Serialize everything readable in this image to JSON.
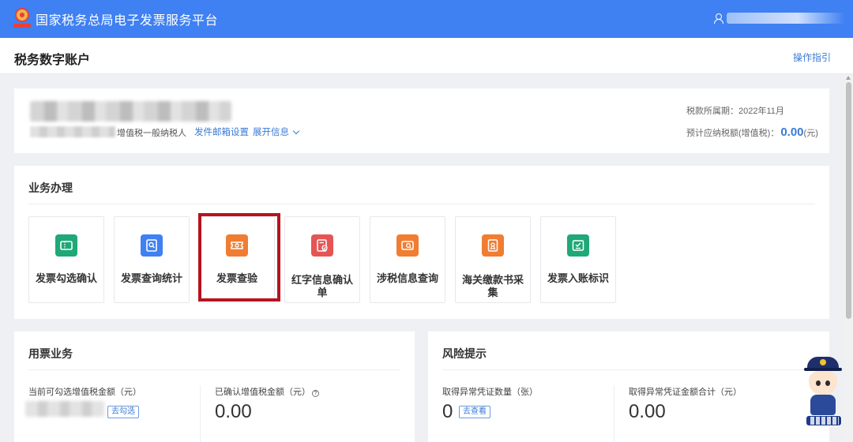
{
  "topbar": {
    "title": "国家税务总局电子发票服务平台",
    "logo_icon": "tax-emblem-icon",
    "user_icon": "user-icon",
    "accent_color": "#3f80f2"
  },
  "header": {
    "page_title": "税务数字账户",
    "guide_link": "操作指引"
  },
  "account": {
    "taxpayer_type": "增值税一般纳税人",
    "email_setting_link": "发件邮箱设置",
    "expand_link": "展开信息",
    "tax_period": "税款所属期：2022年11月",
    "estimated_tax_label": "预计应纳税额(增值税)：",
    "estimated_tax_value": "0.00",
    "estimated_tax_unit": "(元)"
  },
  "business": {
    "title": "业务办理",
    "highlight_color": "#b5141f",
    "tiles": [
      {
        "label": "发票勾选确认",
        "icon": "ticket-check-icon",
        "color": "#1fa878"
      },
      {
        "label": "发票查询统计",
        "icon": "document-search-icon",
        "color": "#3f80f2"
      },
      {
        "label": "发票查验",
        "icon": "ticket-verify-icon",
        "color": "#f07d32"
      },
      {
        "label": "红字信息确认单",
        "icon": "red-form-confirm-icon",
        "color": "#e65555"
      },
      {
        "label": "涉税信息查询",
        "icon": "tax-info-search-icon",
        "color": "#f07d32"
      },
      {
        "label": "海关缴款书采集",
        "icon": "customs-collect-icon",
        "color": "#f07d32"
      },
      {
        "label": "发票入账标识",
        "icon": "invoice-entry-icon",
        "color": "#1fa878"
      }
    ]
  },
  "ticket": {
    "title": "用票业务",
    "selectable_label": "当前可勾选增值税金额（元）",
    "select_button": "去勾选",
    "confirmed_label": "已确认增值税金额（元）",
    "confirmed_value": "0.00"
  },
  "risk": {
    "title": "风险提示",
    "abnormal_count_label": "取得异常凭证数量（张）",
    "abnormal_count_value": "0",
    "view_button": "去查看",
    "abnormal_sum_label": "取得异常凭证金额合计（元）",
    "abnormal_sum_value": "0.00"
  }
}
